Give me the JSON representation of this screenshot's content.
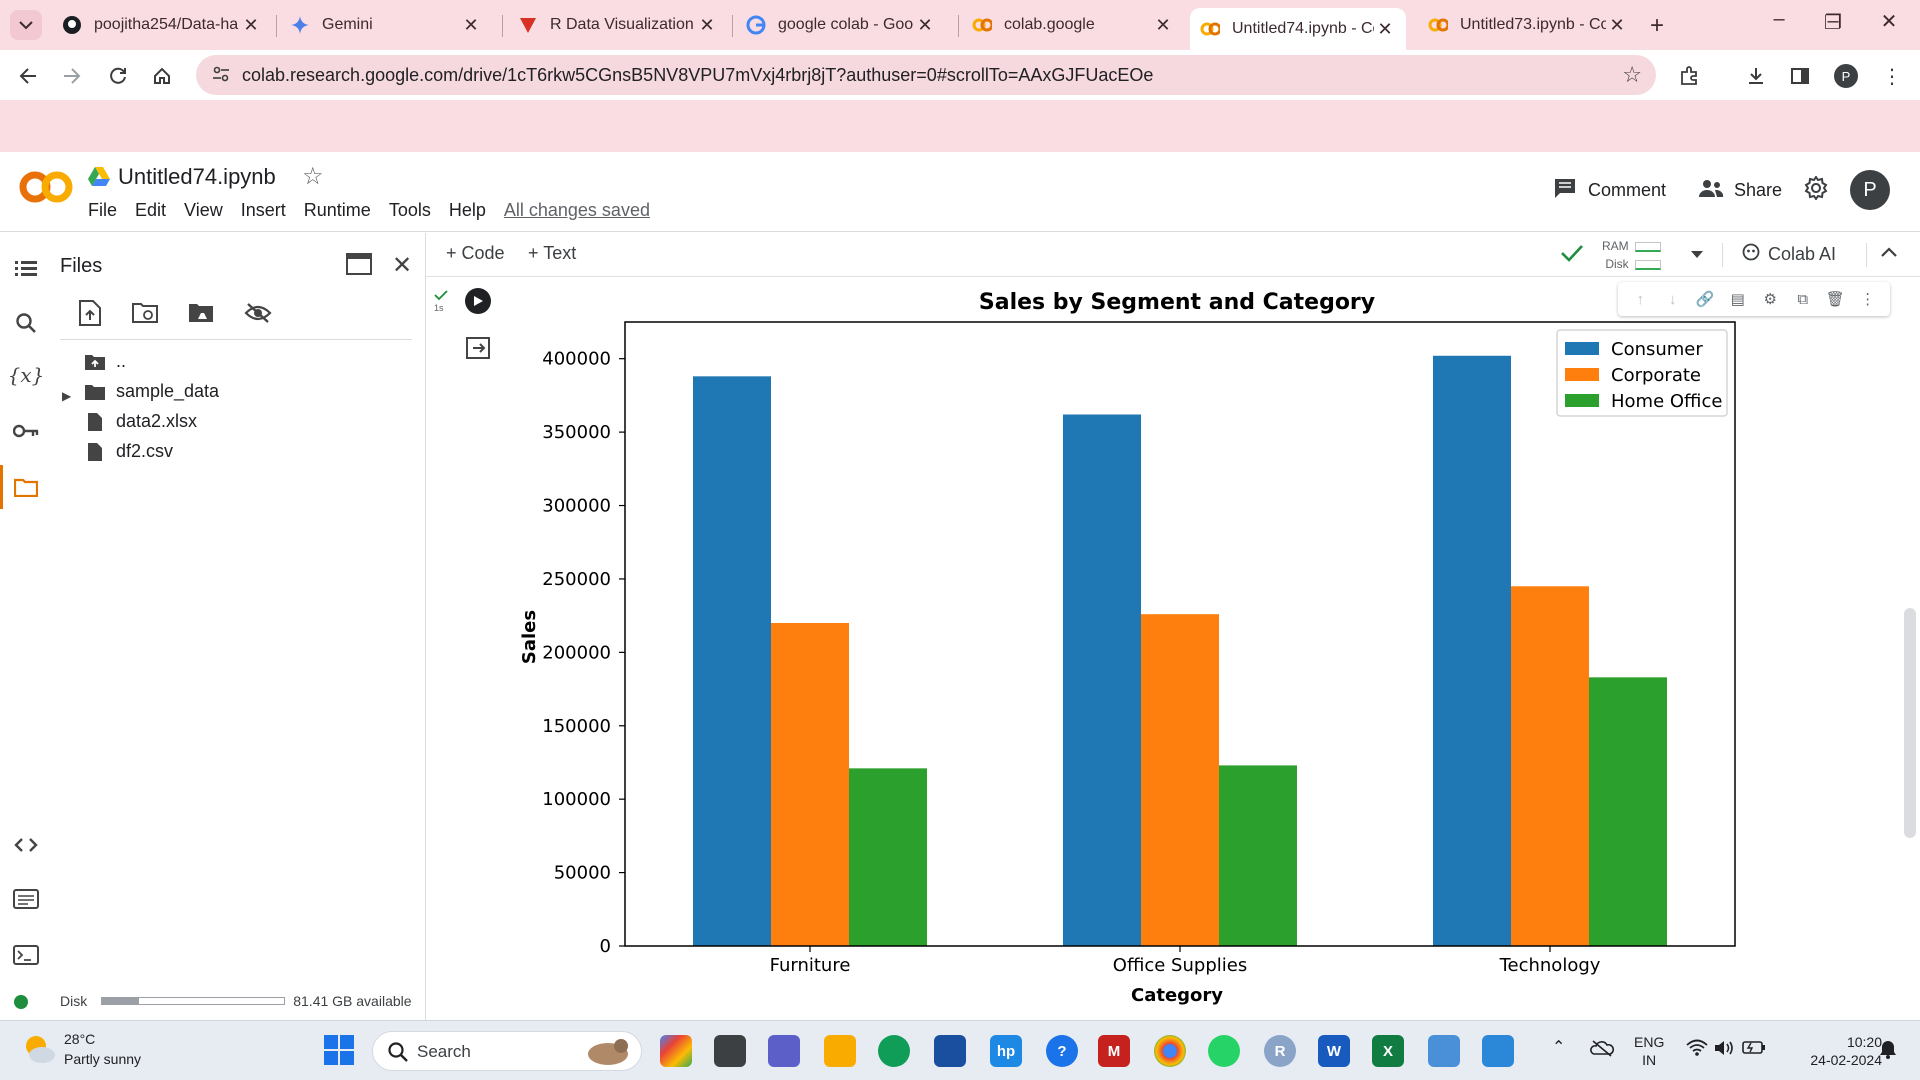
{
  "browser": {
    "tabs": [
      {
        "title": "poojitha254/Data-ha",
        "icon": "github-icon"
      },
      {
        "title": "Gemini",
        "icon": "gemini-icon"
      },
      {
        "title": "R Data Visualization",
        "icon": "red-v-icon"
      },
      {
        "title": "google colab - Goog",
        "icon": "google-icon"
      },
      {
        "title": "colab.google",
        "icon": "colab-icon"
      },
      {
        "title": "Untitled74.ipynb - Co",
        "icon": "colab-icon",
        "active": true
      },
      {
        "title": "Untitled73.ipynb - Co",
        "icon": "colab-icon"
      }
    ],
    "url": "colab.research.google.com/drive/1cT6rkw5CGnsB5NV8VPU7mVxj4rbrj8jT?authuser=0#scrollTo=AAxGJFUacEOe",
    "profile_initial": "P"
  },
  "colab": {
    "notebook_title": "Untitled74.ipynb",
    "menu": [
      "File",
      "Edit",
      "View",
      "Insert",
      "Runtime",
      "Tools",
      "Help"
    ],
    "saved_status": "All changes saved",
    "comment_label": "Comment",
    "share_label": "Share",
    "avatar_initial": "P",
    "add_code": "+ Code",
    "add_text": "+ Text",
    "ram_label": "RAM",
    "disk_label": "Disk",
    "colab_ai_label": "Colab AI",
    "exec_time": "1s",
    "accent_color": "#e37400"
  },
  "files": {
    "title": "Files",
    "items": [
      {
        "name": "..",
        "type": "parent"
      },
      {
        "name": "sample_data",
        "type": "folder"
      },
      {
        "name": "data2.xlsx",
        "type": "file"
      },
      {
        "name": "df2.csv",
        "type": "file"
      }
    ],
    "disk_label": "Disk",
    "disk_available": "81.41 GB available",
    "disk_used_fraction": 0.2
  },
  "chart_data": {
    "type": "bar",
    "title": "Sales by Segment and Category",
    "xlabel": "Category",
    "ylabel": "Sales",
    "categories": [
      "Furniture",
      "Office Supplies",
      "Technology"
    ],
    "series": [
      {
        "name": "Consumer",
        "color": "#1f77b4",
        "values": [
          388000,
          362000,
          402000
        ]
      },
      {
        "name": "Corporate",
        "color": "#ff7f0e",
        "values": [
          220000,
          226000,
          245000
        ]
      },
      {
        "name": "Home Office",
        "color": "#2ca02c",
        "values": [
          121000,
          123000,
          183000
        ]
      }
    ],
    "ylim": [
      0,
      400000
    ],
    "yticks": [
      "0",
      "50000",
      "100000",
      "150000",
      "200000",
      "250000",
      "300000",
      "350000",
      "400000"
    ],
    "ytick_values": [
      0,
      50000,
      100000,
      150000,
      200000,
      250000,
      300000,
      350000,
      400000
    ],
    "legend_position": "top-right",
    "grid": false
  },
  "taskbar": {
    "temperature": "28°C",
    "weather": "Partly sunny",
    "search_placeholder": "Search",
    "lang_top": "ENG",
    "lang_bottom": "IN",
    "time": "10:20",
    "date": "24-02-2024"
  }
}
